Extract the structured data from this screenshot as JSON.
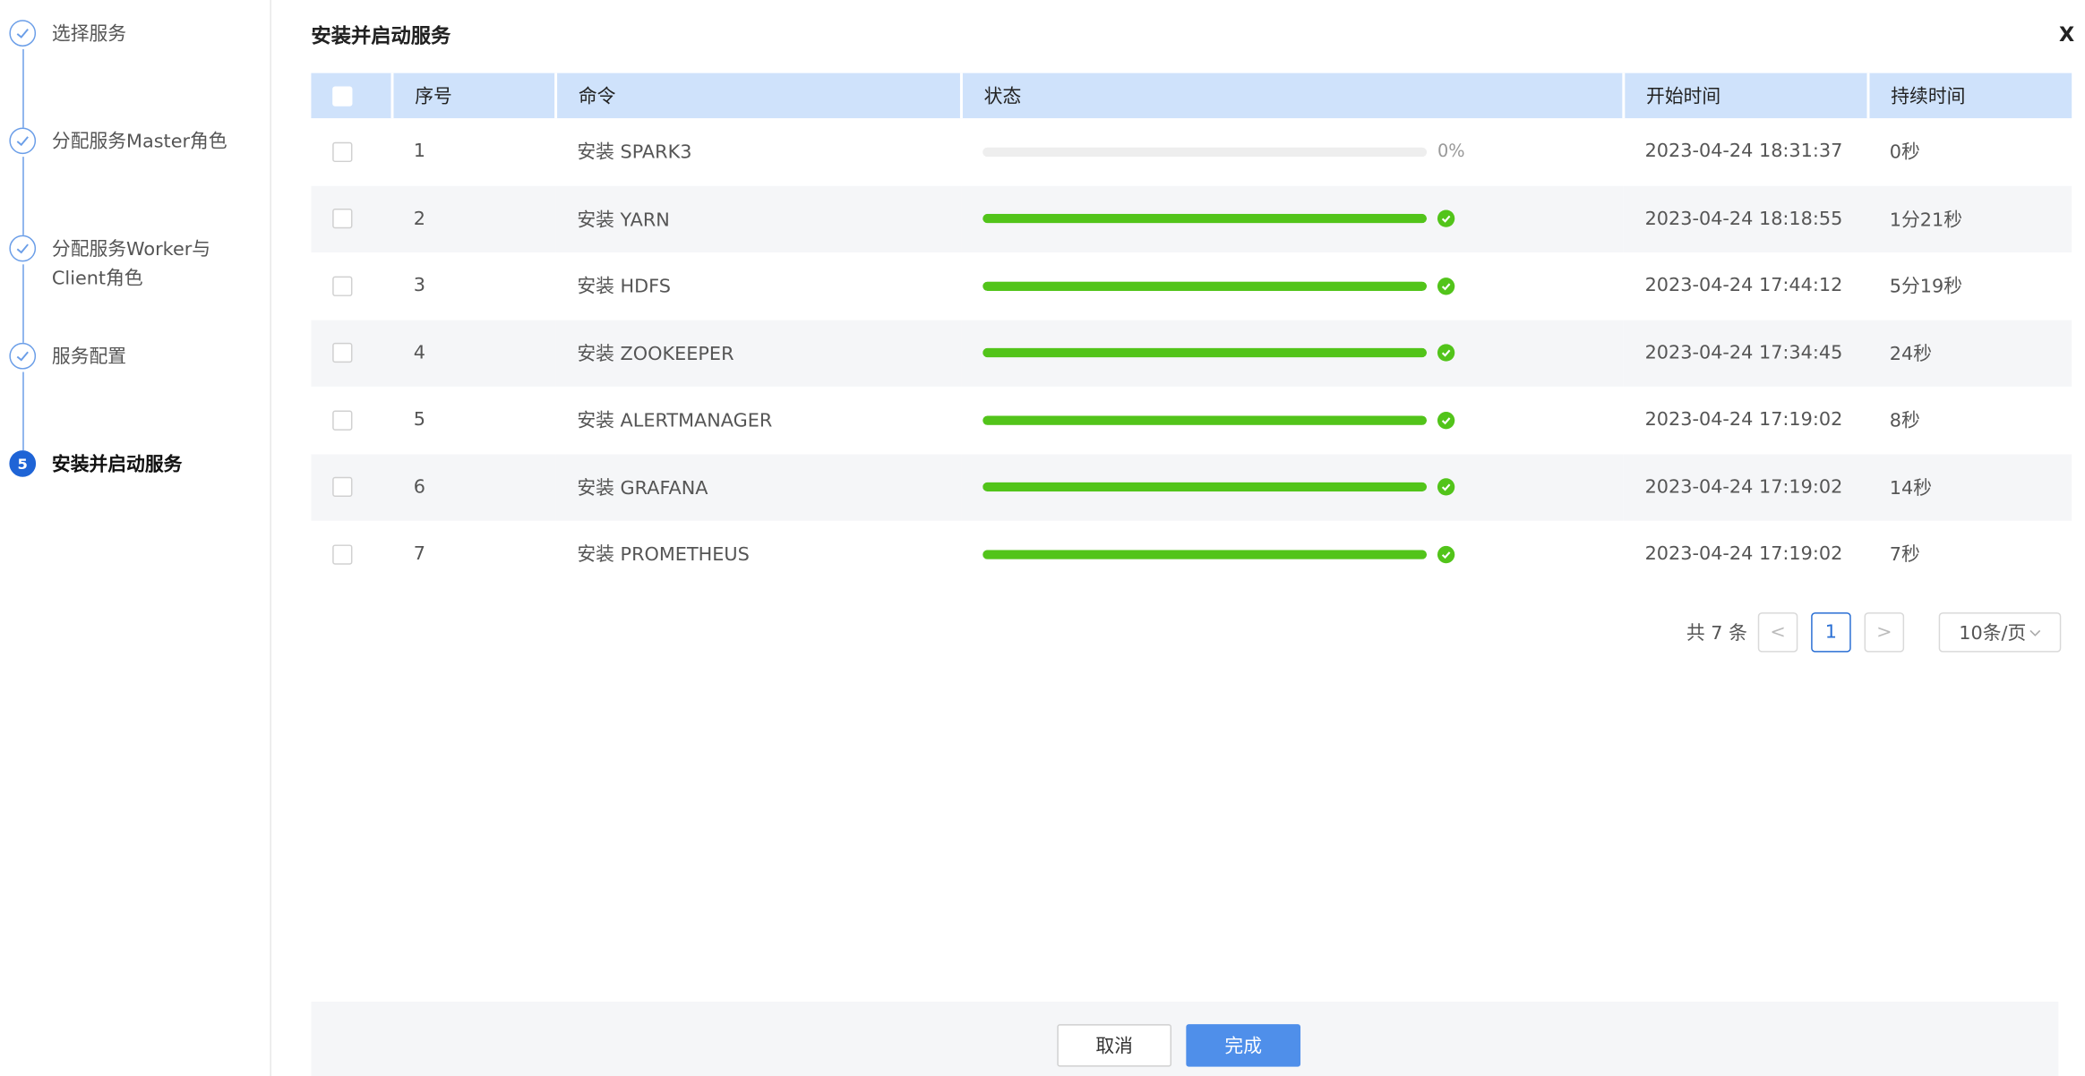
{
  "sidebar": {
    "steps": [
      {
        "label": "选择服务",
        "state": "done"
      },
      {
        "label": "分配服务Master角色",
        "state": "done"
      },
      {
        "label": "分配服务Worker与Client角色",
        "state": "done"
      },
      {
        "label": "服务配置",
        "state": "done"
      },
      {
        "label": "安装并启动服务",
        "state": "active",
        "number": "5"
      }
    ]
  },
  "dialog": {
    "title": "安装并启动服务",
    "close_label": "X"
  },
  "table": {
    "headers": {
      "index": "序号",
      "command": "命令",
      "status": "状态",
      "start": "开始时间",
      "duration": "持续时间"
    },
    "rows": [
      {
        "index": "1",
        "command": "安装 SPARK3",
        "progress": 0,
        "progress_label": "0%",
        "start": "2023-04-24 18:31:37",
        "duration": "0秒"
      },
      {
        "index": "2",
        "command": "安装 YARN",
        "progress": 100,
        "start": "2023-04-24 18:18:55",
        "duration": "1分21秒"
      },
      {
        "index": "3",
        "command": "安装 HDFS",
        "progress": 100,
        "start": "2023-04-24 17:44:12",
        "duration": "5分19秒"
      },
      {
        "index": "4",
        "command": "安装 ZOOKEEPER",
        "progress": 100,
        "start": "2023-04-24 17:34:45",
        "duration": "24秒"
      },
      {
        "index": "5",
        "command": "安装 ALERTMANAGER",
        "progress": 100,
        "start": "2023-04-24 17:19:02",
        "duration": "8秒"
      },
      {
        "index": "6",
        "command": "安装 GRAFANA",
        "progress": 100,
        "start": "2023-04-24 17:19:02",
        "duration": "14秒"
      },
      {
        "index": "7",
        "command": "安装 PROMETHEUS",
        "progress": 100,
        "start": "2023-04-24 17:19:02",
        "duration": "7秒"
      }
    ]
  },
  "pagination": {
    "total": "共 7 条",
    "prev": "<",
    "current": "1",
    "next": ">",
    "page_size": "10条/页"
  },
  "footer": {
    "cancel_label": "取消",
    "done_label": "完成"
  },
  "colors": {
    "accent": "#1f64d6",
    "success": "#52c41a",
    "link": "#2a6fd4",
    "header_bg": "#cfe2fb"
  }
}
